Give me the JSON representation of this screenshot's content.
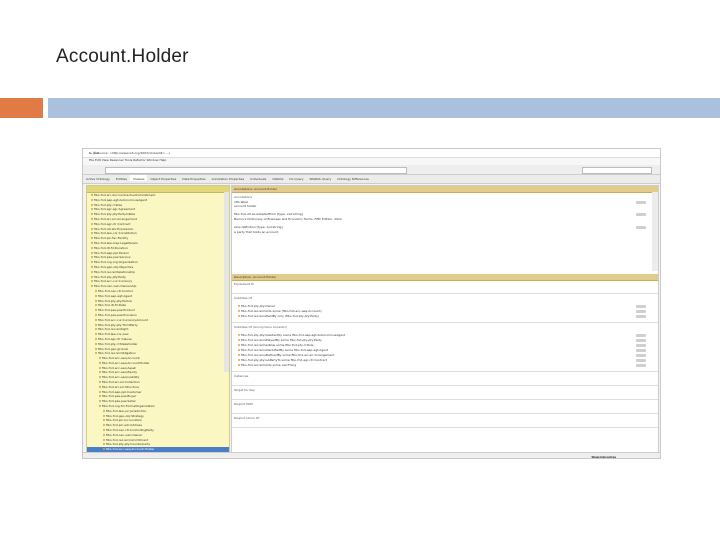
{
  "slide": {
    "title": "Account.Holder"
  },
  "window": {
    "title": "fs (Resource: <http://www.w3.org/2003/11/swrl#> ...)",
    "menu": "File  Edit  View  Reasoner  Tools  Refactor  Window  Help",
    "tabs": [
      "Active Ontology",
      "Entities",
      "Classes",
      "Object Properties",
      "Data Properties",
      "Annotation Properties",
      "Individuals",
      "OWLViz",
      "DL Query",
      "SPARQL Query",
      "Ontology Differences"
    ],
    "active_tab": 2
  },
  "class_tree": {
    "header": "Class hierarchy: Account.Holder",
    "items": [
      "fibo-fnd-arr-doc:ContractualCommitment",
      "fibo-fnd-aap-agt:AutonomousAgent",
      "fibo-fnd-pty-rl:Role",
      "fibo-fnd-agr-agr:Agreement",
      "fibo-fnd-pty-pty:PartyInRole",
      "fibo-fnd-arr-arr:Arrangement",
      "fibo-fnd-agr-ctr:Contract",
      "fibo-fnd-utl-alx:Expression",
      "fibo-fnd-law-cor:Constitution",
      "fibo-fnd-plc-fac:Facility",
      "fibo-fnd-law-lcap:LegalPerson",
      "fibo-fnd-dt-fd:Duration",
      "fibo-fnd-aap-ppl:Person",
      "fibo-fnd-pas-pas:Service",
      "fibo-fnd-org-org:Organization",
      "fibo-fnd-gao-obj:Objective",
      "fibo-fnd-rel-rel:Relationship",
      "fibo-fnd-pty-pty:Party",
      "fibo-fnd-acc-cur:Currency",
      "fibo-fnd-oac-own:Ownership",
      "fibo-fnd-oac-ctl:Control",
      "fibo-fnd-aap-agt:Agent",
      "fibo-fnd-pty-pty:Person",
      "fibo-fnd-dt-fd:Date",
      "fibo-fnd-pas-pas:Product",
      "fibo-fnd-pas-pas:Provision",
      "fibo-fnd-acc-cur:CurrencyAmount",
      "fibo-fnd-pty-pty:ThirdParty",
      "fibo-fnd-rel-rel:Right",
      "fibo-fnd-law-cor:Law",
      "fibo-fnd-agr-ctr:Clause",
      "fibo-fnd-pty-rl:Stakeholder",
      "fibo-fnd-gao-gl:Goal",
      "fibo-fnd-rel-rel:Obligation",
      "fibo-fnd-acc-aeq:Account",
      "fibo-fnd-acc-aeq:AccountHolder",
      "fibo-fnd-acc-aeq:Asset",
      "fibo-fnd-acc-aeq:Equity",
      "fibo-fnd-acc-aeq:Liability",
      "fibo-fnd-arr-arr:Collection",
      "fibo-fnd-arr-arr:Structure",
      "fibo-fnd-aap-ppl:Customer",
      "fibo-fnd-pas-pas:Buyer",
      "fibo-fnd-pas-pas:Seller",
      "fibo-fnd-org-fm:FormalOrganization",
      "fibo-fnd-law-jur:Jurisdiction",
      "fibo-fnd-gao-obj:Strategy",
      "fibo-fnd-plc-loc:Location",
      "fibo-fnd-plc-adr:Address",
      "fibo-fnd-oac-ctl:ControllingParty",
      "fibo-fnd-oac-own:Owner",
      "fibo-fnd-rel-rel:Commitment",
      "fibo-fnd-pty-pty:Counterparty",
      "fibo-fnd-acc-aeq:Account.Holder"
    ],
    "selected_index": 53
  },
  "annotations_panel": {
    "header": "Annotations: Account.Holder",
    "section_label": "Annotations",
    "rows": [
      "rdfs:label",
      "account holder",
      "fibo-fnd-utl-av:adaptedFrom   [type: xsd:string]",
      "Barron's Dictionary of Business and Economic Terms, Fifth Edition, 2012",
      "skos:definition   [type: xsd:string]",
      "a party that holds an account"
    ]
  },
  "description_panel": {
    "header": "Description: Account.Holder",
    "sections": [
      {
        "label": "Equivalent To",
        "rows": []
      },
      {
        "label": "SubClass Of",
        "rows": [
          "fibo-fnd-pty-pty:Owner",
          "fibo-fnd-rel-rel:holds some (fibo-fnd-acc-aeq:Account)",
          "fibo-fnd-rel-rel:isHeldBy only (fibo-fnd-pty-pty:Party)"
        ]
      },
      {
        "label": "SubClass Of (Anonymous Ancestor)",
        "rows": [
          "fibo-fnd-pty-pty:hasIdentity some fibo-fnd-aap-agt:AutonomousAgent",
          "fibo-fnd-rel-rel:isPlayedBy some fibo-fnd-pty-pty:Party",
          "fibo-fnd-rel-rel:hasRole some fibo-fnd-pty-rl:Role",
          "fibo-fnd-rel-rel:isIdentifiedBy some fibo-fnd-aap-agt:Agent",
          "fibo-fnd-rel-rel:isDefinedBy some fibo-fnd-arr-arr:Arrangement",
          "fibo-fnd-pty-pty:isAPartyTo some fibo-fnd-agr-ctr:Contract",
          "fibo-fnd-rel-rel:holds some owl:Thing"
        ]
      },
      {
        "label": "Instances",
        "rows": []
      },
      {
        "label": "Target for Key",
        "rows": []
      },
      {
        "label": "Disjoint With",
        "rows": []
      },
      {
        "label": "Disjoint Union Of",
        "rows": []
      }
    ]
  },
  "status": {
    "reasoner": "Reasoner active",
    "show_inferences": "Show Inferences"
  },
  "colors": {
    "orange_band": "#e07b45",
    "blue_band": "#a9c1dc",
    "tree_bg": "#fbf7c2",
    "panel_header": "#e2cc8b",
    "selection": "#4a7fc8"
  }
}
